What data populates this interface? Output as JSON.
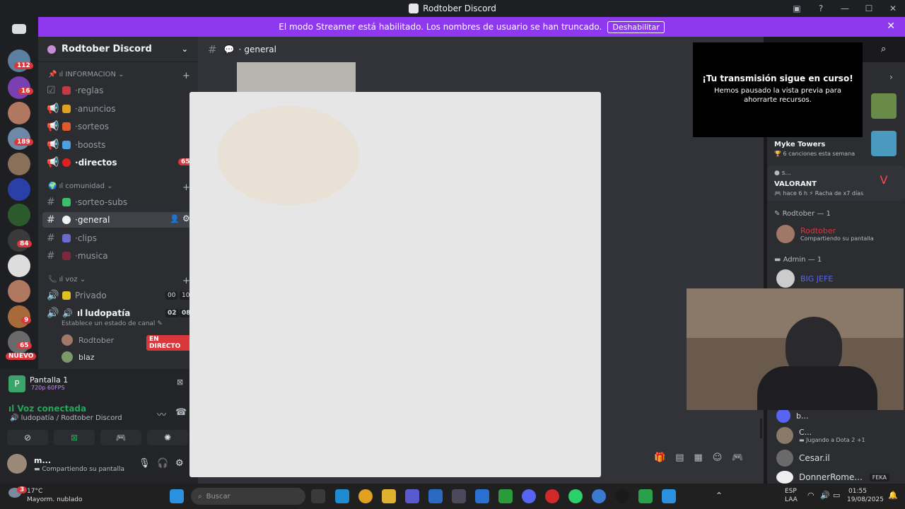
{
  "window": {
    "title": "Rodtober Discord"
  },
  "banner": {
    "text": "El modo Streamer está habilitado. Los nombres de usuario se han truncado.",
    "button": "Deshabilitar"
  },
  "guilds": {
    "badges": [
      "112",
      "16",
      "189",
      "84",
      "9",
      "65"
    ],
    "new_label": "NUEVO"
  },
  "server": {
    "name": "Rodtober Discord"
  },
  "categories": {
    "info": "INFORMACION",
    "comunidad": "comunidad",
    "voz": "voz"
  },
  "channels": {
    "reglas": "reglas",
    "anuncios": "anuncios",
    "sorteos": "sorteos",
    "boosts": "boosts",
    "directos": "directos",
    "directos_badge": "65",
    "sorteo_subs": "sorteo-subs",
    "general": "general",
    "clips": "clips",
    "musica": "musica",
    "privado": "Privado",
    "privado_a": "00",
    "privado_b": "10",
    "ludopatia": "ludopatía",
    "ludo_a": "02",
    "ludo_b": "08",
    "status_hint": "Establece un estado de canal"
  },
  "voice_users": {
    "u1": "Rodtober",
    "u1_badge": "EN DIRECTO",
    "u2": "blaz"
  },
  "screenshare": {
    "title": "Pantalla 1",
    "quality": "720p 60FPS"
  },
  "voice": {
    "connected": "Voz conectada",
    "channel": "ludopatía / Rodtober Discord"
  },
  "user": {
    "name": "m...",
    "status": "Compartiendo su pantalla"
  },
  "header": {
    "channel": "general"
  },
  "toast": {
    "title": "¡Tu transmisión sigue en curso!",
    "body": "Hemos pausado la vista previa para ahorrarte recursos."
  },
  "activity": {
    "a1_name": "Myke Towers",
    "a1_sub": "6 canciones esta semana",
    "a2_user": "s...",
    "a2_name": "VALORANT",
    "a2_time": "hace 6 h",
    "a2_streak": "Racha de x7 días"
  },
  "members": {
    "role1": "Rodtober — 1",
    "m1": "Rodtober",
    "m1_status": "Compartiendo su pantalla",
    "role2": "Admin — 1",
    "m2": "BIG JEFE",
    "m3": "b...",
    "m4": "C...",
    "m4_status": "Jugando a Dota 2",
    "m4_extra": "+1",
    "m5": "Cesar.il",
    "m6": "DonnerRome...",
    "m6_tag": "FEKA"
  },
  "taskbar": {
    "weather_temp": "17°C",
    "weather_desc": "Mayorm. nublado",
    "weather_badge": "3",
    "search_placeholder": "Buscar",
    "lang1": "ESP",
    "lang2": "LAA",
    "time": "01:55",
    "date": "19/08/2025"
  },
  "colors": {
    "accent": "#8e38f0",
    "sidebar": "#2b2d31",
    "main": "#313338",
    "danger": "#da373c",
    "green": "#23a55a"
  }
}
